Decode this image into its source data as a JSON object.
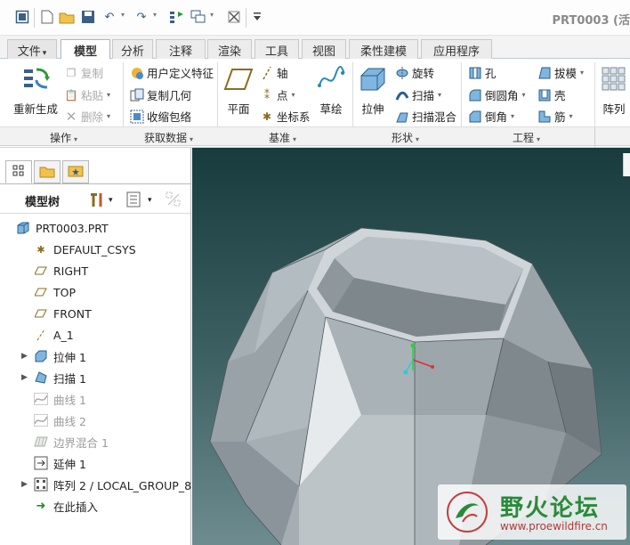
{
  "window": {
    "title": "PRT0003 (活"
  },
  "tabs": [
    {
      "label": "文件",
      "caret": "▾"
    },
    {
      "label": "模型"
    },
    {
      "label": "分析"
    },
    {
      "label": "注释"
    },
    {
      "label": "渲染"
    },
    {
      "label": "工具"
    },
    {
      "label": "视图"
    },
    {
      "label": "柔性建模"
    },
    {
      "label": "应用程序"
    }
  ],
  "ribbon": {
    "operations": {
      "regenerate": "重新生成",
      "copy": "复制",
      "paste": "粘贴",
      "delete": "删除"
    },
    "get_data": {
      "udf": "用户定义特征",
      "copy_geometry": "复制几何",
      "shrinkwrap": "收缩包络"
    },
    "datum": {
      "plane": "平面",
      "axis": "轴",
      "point": "点",
      "csys": "坐标系",
      "sketch": "草绘"
    },
    "shapes": {
      "extrude": "拉伸",
      "revolve": "旋转",
      "sweep": "扫描",
      "swept_blend": "扫描混合"
    },
    "engineering": {
      "hole": "孔",
      "draft": "拔模",
      "round": "倒圆角",
      "shell": "壳",
      "chamfer": "倒角",
      "rib": "筋"
    },
    "pattern": "阵列"
  },
  "group_labels": [
    "操作",
    "获取数据",
    "基准",
    "形状",
    "工程"
  ],
  "panel": {
    "title": "模型树"
  },
  "tree": [
    {
      "label": "PRT0003.PRT"
    },
    {
      "label": "DEFAULT_CSYS"
    },
    {
      "label": "RIGHT"
    },
    {
      "label": "TOP"
    },
    {
      "label": "FRONT"
    },
    {
      "label": "A_1"
    },
    {
      "label": "拉伸 1"
    },
    {
      "label": "扫描 1"
    },
    {
      "label": "曲线 1"
    },
    {
      "label": "曲线 2"
    },
    {
      "label": "边界混合 1"
    },
    {
      "label": "延伸 1"
    },
    {
      "label": "阵列 2 / LOCAL_GROUP_8"
    },
    {
      "label": "在此插入"
    }
  ],
  "watermark": {
    "title": "野火论坛",
    "url": "www.proewildfire.cn"
  },
  "colors": {
    "viewport_top": "#183b3d",
    "viewport_bottom": "#6e8c90",
    "part": "#a9b3b8",
    "insert_arrow": "#1f8a2a"
  }
}
